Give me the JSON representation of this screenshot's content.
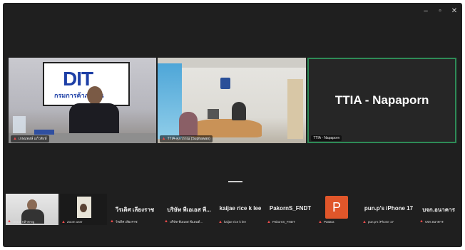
{
  "window_controls": {
    "minimize": "–",
    "restore": "▫",
    "close": "✕"
  },
  "main_tiles": [
    {
      "label": "เกษมพงษ์ แก้วสิงห์"
    },
    {
      "label": "TTIA-ศุภวรรณ (Suphawan)"
    },
    {
      "name": "TTIA - Napaporn",
      "label": "TTIA - Napaporn"
    }
  ],
  "logo": {
    "dit_text": "DIT",
    "thai_text": "กรมการค้าภายใน"
  },
  "filmstrip": [
    {
      "label": "นฤมล กล้าหาญ"
    },
    {
      "label": "Zoom user"
    },
    {
      "name": "วีรเดิศ เลียงราช",
      "label": "วีรเดิศ เลียงราช"
    },
    {
      "name": "บริษัท พีเอเอส พี...",
      "label": "บริษัท พีเอเอส พีแอนด์..."
    },
    {
      "name": "kaijae rice  k lee",
      "label": "kaijae rice  k lee"
    },
    {
      "name": "PakornS_FNDT",
      "label": "PakornS_FNDT"
    },
    {
      "avatar": "P",
      "label": "Pattara"
    },
    {
      "name": "pun.p's iPhone 17",
      "label": "pun.p's iPhone 17"
    },
    {
      "name": "บจก.อนาคาร",
      "label": "บจก.อนาคาร"
    }
  ],
  "colors": {
    "active_speaker_border": "#2e8b57",
    "avatar_bg": "#e0562a",
    "mic_off": "#e84a4a"
  }
}
